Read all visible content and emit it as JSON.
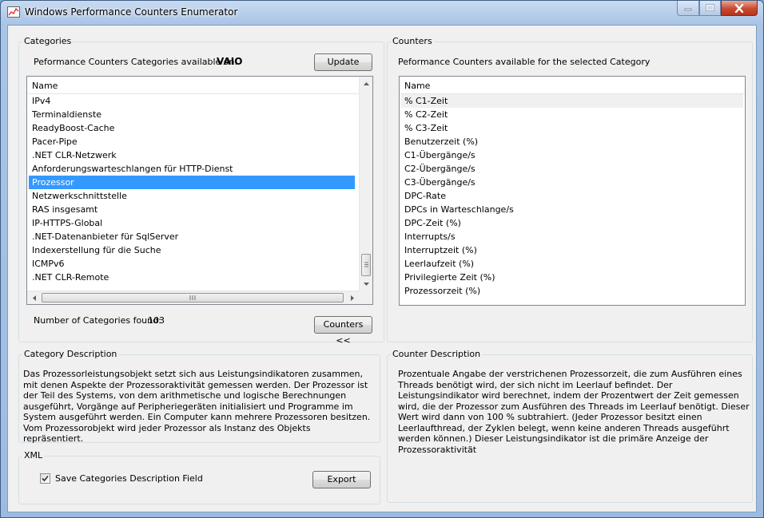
{
  "window": {
    "title": "Windows Performance Counters Enumerator"
  },
  "categories": {
    "group_title": "Categories",
    "available_label": "Peformance Counters Categories available on:",
    "machine_name": "VAIO",
    "update_label": "Update",
    "column_header": "Name",
    "items": [
      "IPv4",
      "Terminaldienste",
      "ReadyBoost-Cache",
      "Pacer-Pipe",
      ".NET CLR-Netzwerk",
      "Anforderungswarteschlangen für HTTP-Dienst",
      "Prozessor",
      "Netzwerkschnittstelle",
      "RAS insgesamt",
      "IP-HTTPS-Global",
      ".NET-Datenanbieter für SqlServer",
      "Indexerstellung für die Suche",
      "ICMPv6",
      ".NET CLR-Remote"
    ],
    "selected_item": "Prozessor",
    "count_label": "Number of Categories found:",
    "count_value": "103",
    "counters_button_label": "Counters <<"
  },
  "counters": {
    "group_title": "Counters",
    "available_label": "Peformance Counters available for the selected Category",
    "column_header": "Name",
    "items": [
      "% C1-Zeit",
      "% C2-Zeit",
      "% C3-Zeit",
      "Benutzerzeit (%)",
      "C1-Übergänge/s",
      "C2-Übergänge/s",
      "C3-Übergänge/s",
      "DPC-Rate",
      "DPCs in Warteschlange/s",
      "DPC-Zeit (%)",
      "Interrupts/s",
      "Interruptzeit (%)",
      "Leerlaufzeit (%)",
      "Privilegierte Zeit (%)",
      "Prozessorzeit (%)"
    ],
    "highlighted_item": "% C1-Zeit"
  },
  "category_description": {
    "group_title": "Category Description",
    "text": "Das Prozessorleistungsobjekt setzt sich aus Leistungsindikatoren zusammen, mit denen Aspekte der Prozessoraktivität gemessen werden. Der Prozessor ist der Teil des Systems, von dem arithmetische und logische Berechnungen ausgeführt, Vorgänge auf Peripheriegeräten initialisiert und Programme im System ausgeführt werden. Ein Computer kann mehrere Prozessoren besitzen. Vom Prozessorobjekt wird jeder Prozessor als Instanz des Objekts repräsentiert."
  },
  "counter_description": {
    "group_title": "Counter Description",
    "text": "Prozentuale Angabe der verstrichenen Prozessorzeit, die zum Ausführen eines Threads benötigt wird, der sich nicht im Leerlauf befindet. Der Leistungsindikator wird berechnet, indem der Prozentwert der Zeit gemessen wird, die der Prozessor zum Ausführen des Threads im Leerlauf benötigt. Dieser Wert wird dann von 100 % subtrahiert. (Jeder Prozessor besitzt einen Leerlaufthread, der Zyklen belegt, wenn keine anderen Threads ausgeführt werden können.)  Dieser Leistungsindikator ist die primäre Anzeige der Prozessoraktivität"
  },
  "xml": {
    "group_title": "XML",
    "checkbox_label": "Save Categories Description Field",
    "checkbox_checked": true,
    "export_label": "Export"
  },
  "icons": {
    "app": "performance-chart-icon",
    "minimize": "minimize-icon",
    "maximize": "maximize-icon",
    "close": "close-icon"
  },
  "colors": {
    "selection": "#3399ff",
    "close_button": "#c94a30",
    "window_frame": "#a9c4e6"
  }
}
